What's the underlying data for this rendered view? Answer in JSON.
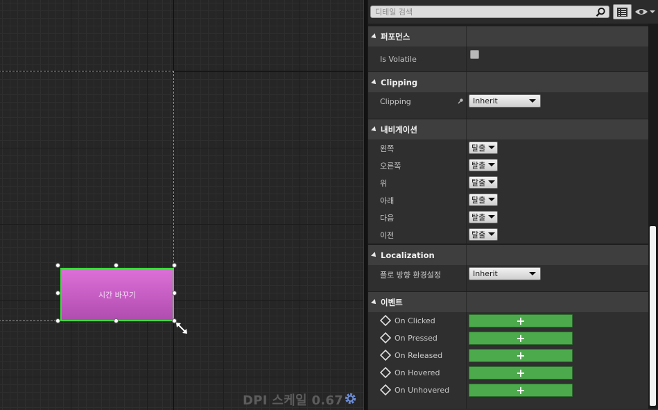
{
  "canvas": {
    "widget_label": "시간 바꾸기",
    "dpi_label": "DPI 스케일 0.67",
    "dpi_icon": "gear-icon",
    "widget_color": "#c760c6",
    "selection_color": "#3cdc3c"
  },
  "details": {
    "search": {
      "placeholder": "디테일 검색",
      "value": ""
    },
    "sections": {
      "performance": {
        "title": "퍼포먼스",
        "is_volatile_label": "Is Volatile",
        "is_volatile_checked": false
      },
      "clipping": {
        "title": "Clipping",
        "clipping_label": "Clipping",
        "clipping_value": "Inherit"
      },
      "navigation": {
        "title": "내비게이션",
        "rows": [
          {
            "label": "왼쪽",
            "value": "탈출"
          },
          {
            "label": "오른쪽",
            "value": "탈출"
          },
          {
            "label": "위",
            "value": "탈출"
          },
          {
            "label": "아래",
            "value": "탈출"
          },
          {
            "label": "다음",
            "value": "탈출"
          },
          {
            "label": "이전",
            "value": "탈출"
          }
        ]
      },
      "localization": {
        "title": "Localization",
        "flow_label": "플로 방향 환경설정",
        "flow_value": "Inherit"
      },
      "events": {
        "title": "이벤트",
        "add_symbol": "+",
        "add_color": "#4caa4c",
        "rows": [
          {
            "label": "On Clicked"
          },
          {
            "label": "On Pressed"
          },
          {
            "label": "On Released"
          },
          {
            "label": "On Hovered"
          },
          {
            "label": "On Unhovered"
          }
        ]
      }
    }
  }
}
